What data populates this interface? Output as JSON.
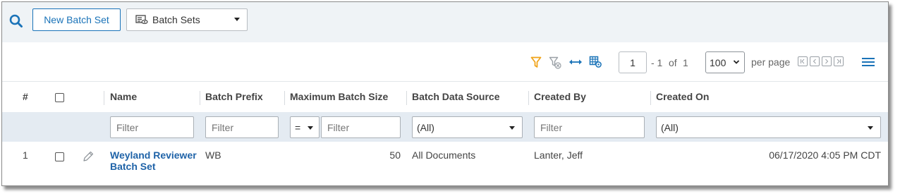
{
  "toolbar": {
    "new_button_label": "New Batch Set",
    "view_select_value": "Batch Sets",
    "icons": {
      "search": "search-icon",
      "view": "list-view-icon"
    }
  },
  "pager": {
    "icons": [
      "filter-icon",
      "clear-filter-icon",
      "fit-columns-icon",
      "grid-settings-icon",
      "menu-icon"
    ],
    "current_page": "1",
    "range_text": "- 1",
    "of_label": "of",
    "total_pages": "1",
    "per_page_value": "100",
    "per_page_label": "per page"
  },
  "table": {
    "columns": [
      "#",
      "Name",
      "Batch Prefix",
      "Maximum Batch Size",
      "Batch Data Source",
      "Created By",
      "Created On"
    ],
    "filters": {
      "placeholder": "Filter",
      "operator": "=",
      "data_source_value": "(All)",
      "created_on_value": "(All)"
    },
    "rows": [
      {
        "index": "1",
        "name_line1": "Weyland Reviewer",
        "name_line2": "Batch Set",
        "batch_prefix": "WB",
        "max_batch_size": "50",
        "data_source": "All Documents",
        "created_by": "Lanter, Jeff",
        "created_on": "06/17/2020 4:05 PM CDT"
      }
    ]
  },
  "colors": {
    "accent": "#1a73b8",
    "toolbar_bg": "#eff3f6",
    "filter_row_bg": "#e4ebf2",
    "filter_icon": "#f0a318",
    "link": "#1f63a8"
  }
}
